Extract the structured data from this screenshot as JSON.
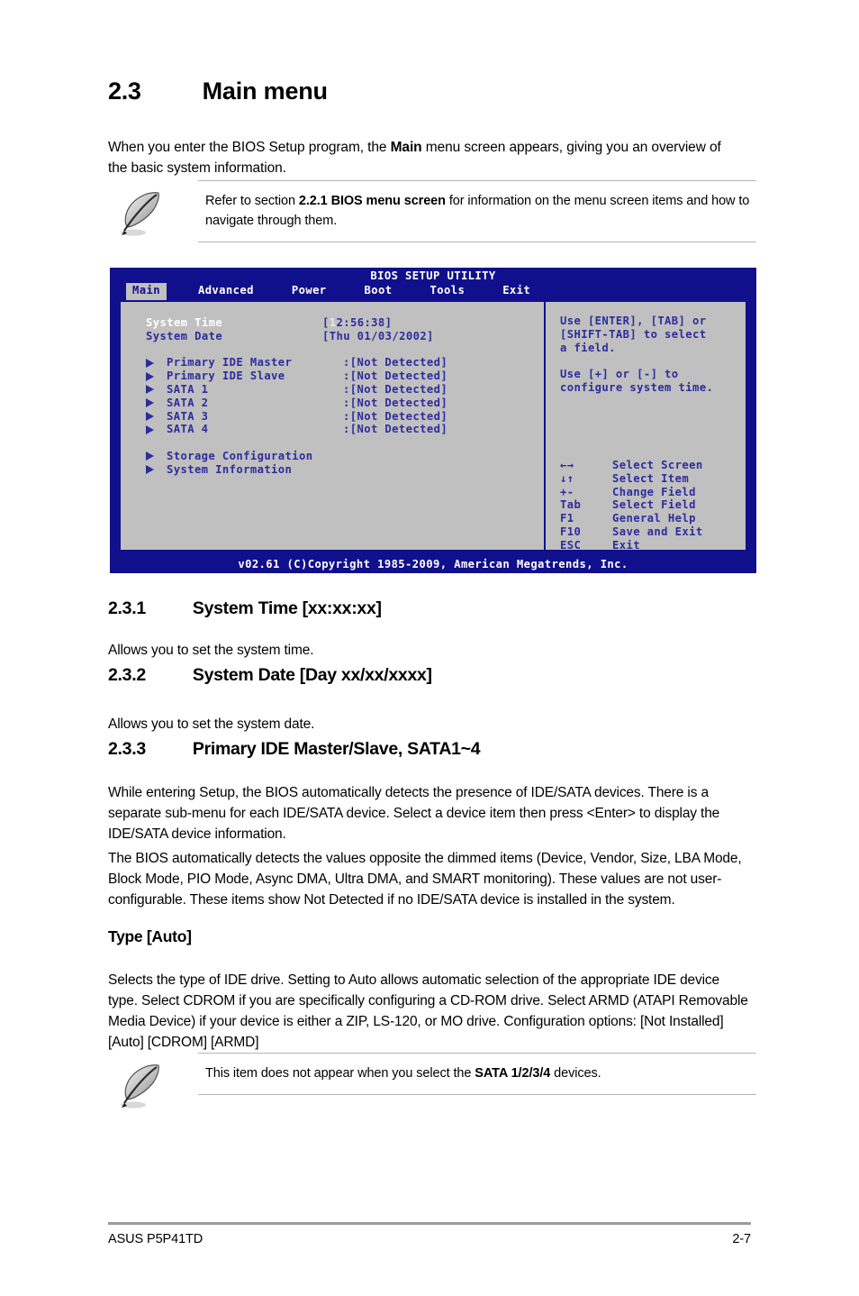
{
  "document": {
    "section_number": "2.3",
    "section_title": "Main menu",
    "intro_pre": "When you enter the BIOS Setup program, the ",
    "intro_bold": "Main",
    "intro_post": " menu screen appears, giving you an overview of the basic system information."
  },
  "note_1": {
    "icon": "feather-pen-icon",
    "pre": "Refer to section ",
    "bold": "2.2.1 BIOS menu screen",
    "post": " for information on the menu screen items and how to navigate through them."
  },
  "note_2": {
    "icon": "feather-pen-icon",
    "pre": "This item does not appear when you select the ",
    "bold": "SATA 1/2/3/4",
    "post": " devices."
  },
  "bios": {
    "title": "BIOS SETUP UTILITY",
    "tabs": [
      {
        "label": "Main",
        "selected": true
      },
      {
        "label": "Advanced",
        "selected": false
      },
      {
        "label": "Power",
        "selected": false
      },
      {
        "label": "Boot",
        "selected": false
      },
      {
        "label": "Tools",
        "selected": false
      },
      {
        "label": "Exit",
        "selected": false
      }
    ],
    "fields": [
      {
        "label": "System Time",
        "value_prefix": "[",
        "value_cursor": "1",
        "value_rest": "2:56:38]",
        "selected": true
      },
      {
        "label": "System Date",
        "value": "[Thu 01/03/2002]",
        "selected": false
      }
    ],
    "items": [
      {
        "label": "Primary IDE Master",
        "value": ":[Not Detected]"
      },
      {
        "label": "Primary IDE Slave",
        "value": ":[Not Detected]"
      },
      {
        "label": "SATA 1",
        "value": ":[Not Detected]"
      },
      {
        "label": "SATA 2",
        "value": ":[Not Detected]"
      },
      {
        "label": "SATA 3",
        "value": ":[Not Detected]"
      },
      {
        "label": "SATA 4",
        "value": ":[Not Detected]"
      }
    ],
    "submenus": [
      {
        "label": "Storage Configuration"
      },
      {
        "label": "System Information"
      }
    ],
    "help": [
      "Use [ENTER], [TAB] or",
      "[SHIFT-TAB] to select",
      "a field.",
      "",
      "Use [+] or [-] to",
      "configure system time."
    ],
    "keys": [
      {
        "key": "←→",
        "desc": "Select Screen"
      },
      {
        "key": "↓↑",
        "desc": "Select Item"
      },
      {
        "key": "+-",
        "desc": "Change Field"
      },
      {
        "key": "Tab",
        "desc": "Select Field"
      },
      {
        "key": "F1",
        "desc": "General Help"
      },
      {
        "key": "F10",
        "desc": "Save and Exit"
      },
      {
        "key": "ESC",
        "desc": "Exit"
      }
    ],
    "footer": "v02.61  (C)Copyright 1985-2009, American Megatrends, Inc.",
    "colors": {
      "chrome_blue": "#10108c",
      "panel_gray": "#c0c0c0",
      "text_blue": "#2c2c9e",
      "highlight_white": "#ffffff"
    }
  },
  "sections": [
    {
      "number": "2.3.1",
      "title": "System Time [xx:xx:xx]",
      "body": "Allows you to set the system time."
    },
    {
      "number": "2.3.2",
      "title": "System Date [Day xx/xx/xxxx]",
      "body": "Allows you to set the system date."
    },
    {
      "number": "2.3.3",
      "title": "Primary IDE Master/Slave, SATA1~4",
      "body_1": "While entering Setup, the BIOS automatically detects the presence of IDE/SATA devices. There is a separate sub-menu for each IDE/SATA device. Select a device item then press <Enter> to display the IDE/SATA device information.",
      "body_2": "The BIOS automatically detects the values opposite the dimmed items (Device, Vendor, Size, LBA Mode, Block Mode, PIO Mode, Async DMA, Ultra DMA, and SMART monitoring). These values are not user-configurable. These items show Not Detected if no IDE/SATA device is installed in the system."
    }
  ],
  "subsection_type": {
    "heading": "Type [Auto]",
    "body": "Selects the type of IDE drive. Setting to Auto allows automatic selection of the appropriate IDE device type. Select CDROM if you are specifically configuring a CD-ROM drive. Select ARMD (ATAPI Removable Media Device) if your device is either a ZIP, LS-120, or MO drive. Configuration options: [Not Installed] [Auto] [CDROM] [ARMD]"
  },
  "footer": {
    "left": "ASUS P5P41TD",
    "page": "2-7"
  }
}
